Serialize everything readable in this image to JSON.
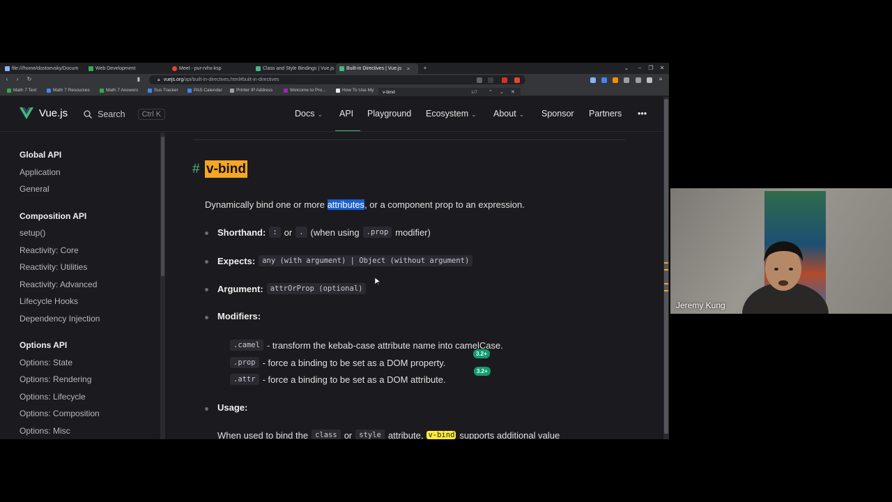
{
  "browser": {
    "tabs": [
      {
        "title": "file:///home/dostoevsky/Docum",
        "color": "#8ab4f8",
        "active": false
      },
      {
        "title": "Web Development",
        "color": "#34a853",
        "active": false
      },
      {
        "title": "Meet - pur-rvhx-ksp",
        "color": "#ea4335",
        "active": false
      },
      {
        "title": "Class and Style Bindings | Vue.js",
        "color": "#42b883",
        "active": false
      },
      {
        "title": "Built-in Directives | Vue.js",
        "color": "#42b883",
        "active": true
      }
    ],
    "url_host": "vuejs.org",
    "url_path": "/api/built-in-directives.html#built-in-directives",
    "bookmarks": [
      {
        "label": "Math 7 Text",
        "color": "#34a853"
      },
      {
        "label": "Math 7 Resources",
        "color": "#4285f4"
      },
      {
        "label": "Math 7 Answers",
        "color": "#34a853"
      },
      {
        "label": "Sus Tracker",
        "color": "#4285f4"
      },
      {
        "label": "PAS Calendar",
        "color": "#4285f4"
      },
      {
        "label": "Printer IP Address",
        "color": "#9aa0a6"
      },
      {
        "label": "Welcome to Pro...",
        "color": "#9c27b0"
      },
      {
        "label": "How To Use My",
        "color": "#e8eaed"
      }
    ],
    "find": {
      "query": "v-bind",
      "count": "1/7"
    }
  },
  "site": {
    "brand": "Vue.js",
    "search_label": "Search",
    "search_shortcut": "Ctrl K",
    "nav": {
      "docs": "Docs",
      "api": "API",
      "playground": "Playground",
      "ecosystem": "Ecosystem",
      "about": "About",
      "sponsor": "Sponsor",
      "partners": "Partners",
      "more": "•••"
    }
  },
  "sidebar": {
    "groups": [
      {
        "heading": "Global API",
        "items": [
          "Application",
          "General"
        ]
      },
      {
        "heading": "Composition API",
        "items": [
          "setup()",
          "Reactivity: Core",
          "Reactivity: Utilities",
          "Reactivity: Advanced",
          "Lifecycle Hooks",
          "Dependency Injection"
        ]
      },
      {
        "heading": "Options API",
        "items": [
          "Options: State",
          "Options: Rendering",
          "Options: Lifecycle",
          "Options: Composition",
          "Options: Misc"
        ]
      }
    ]
  },
  "content": {
    "hash": "#",
    "title": "v-bind",
    "desc_before": "Dynamically bind one or more ",
    "desc_highlight": "attributes",
    "desc_after": ", or a component prop to an expression.",
    "shorthand": {
      "label": "Shorthand:",
      "code1": ":",
      "or": "or",
      "code2": ".",
      "middle": "(when using",
      "code3": ".prop",
      "end": "modifier)"
    },
    "expects": {
      "label": "Expects:",
      "code": "any (with argument) | Object (without argument)"
    },
    "argument": {
      "label": "Argument:",
      "code": "attrOrProp (optional)"
    },
    "modifiers": {
      "label": "Modifiers:",
      "items": [
        {
          "code": ".camel",
          "text": "- transform the kebab-case attribute name into camelCase.",
          "badge": ""
        },
        {
          "code": ".prop",
          "text": "- force a binding to be set as a DOM property.",
          "badge": "3.2+"
        },
        {
          "code": ".attr",
          "text": "- force a binding to be set as a DOM attribute.",
          "badge": "3.2+"
        }
      ]
    },
    "usage": {
      "label": "Usage:"
    },
    "usage_line": {
      "before": "When used to bind the",
      "code1": "class",
      "or": "or",
      "code2": "style",
      "mid": "attribute,",
      "hl": "v-bind",
      "after": "supports additional value"
    }
  },
  "video": {
    "participant": "Jeremy Kung"
  }
}
